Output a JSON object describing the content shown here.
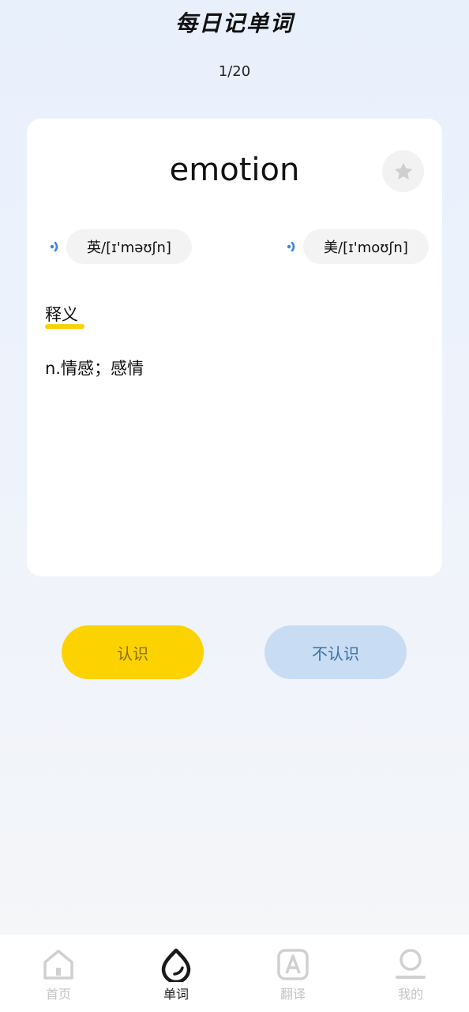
{
  "header": {
    "title": "每日记单词",
    "progress": "1/20"
  },
  "card": {
    "word": "emotion",
    "phonetics": {
      "uk": "英/[ɪ'məʊʃn]",
      "us": "美/[ɪ'moʊʃn]"
    },
    "definition_label": "释义",
    "definition": "n.情感；感情"
  },
  "actions": {
    "know_label": "认识",
    "unknown_label": "不认识"
  },
  "tabbar": {
    "items": [
      {
        "label": "首页",
        "icon": "home-icon"
      },
      {
        "label": "单词",
        "icon": "word-drop-icon"
      },
      {
        "label": "翻译",
        "icon": "translate-icon"
      },
      {
        "label": "我的",
        "icon": "profile-icon"
      }
    ],
    "active_index": 1
  },
  "colors": {
    "accent_yellow": "#fcd201",
    "accent_blue": "#c8dcf3",
    "speaker_blue": "#3b86e0",
    "inactive_tab": "#c4c4c4"
  }
}
